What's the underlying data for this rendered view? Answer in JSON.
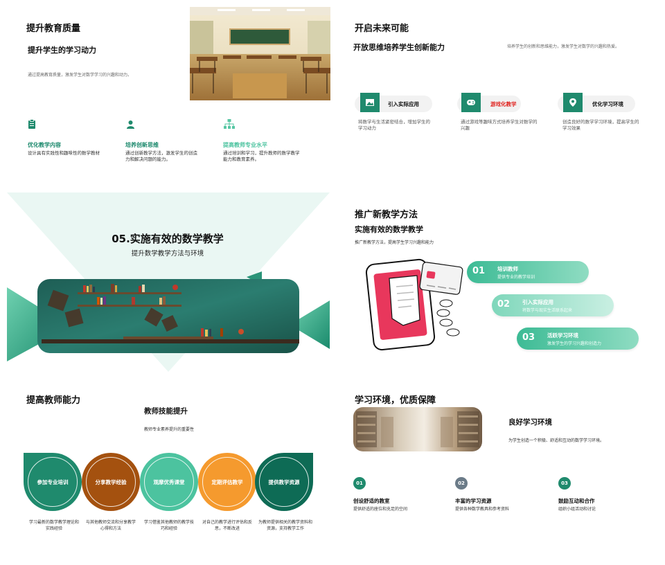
{
  "slide1": {
    "title": "提升教育质量",
    "subtitle": "提升学生的学习动力",
    "desc": "通过提高教育质量，激发学生对数学学习的兴趣和动力。",
    "features": [
      {
        "title": "优化教学内容",
        "desc": "设计具有实践性和趣味性的数学教材",
        "icon": "clipboard-icon"
      },
      {
        "title": "培养创新思维",
        "desc": "通过创新教学方法，激发学生的创造力和解决问题的能力。",
        "icon": "person-icon"
      },
      {
        "title": "提高教师专业水平",
        "desc": "通过培训和学习，提升教师的数学教学能力和教育素养。",
        "icon": "org-chart-icon"
      }
    ]
  },
  "slide2": {
    "title": "开启未来可能",
    "subtitle": "开放思维培养学生创新能力",
    "desc": "培养学生的创新和思维能力，激发学生对数学的兴趣和热爱。",
    "cards": [
      {
        "label": "引入实际应用",
        "desc": "将数学与生活紧密结合，增加学生的学习动力",
        "icon": "image-icon"
      },
      {
        "label": "游戏化教学",
        "desc": "通过游戏等趣味方式培养学生对数学的兴趣",
        "icon": "gamepad-icon"
      },
      {
        "label": "优化学习环境",
        "desc": "创造良好的数学学习环境，提高学生的学习效果",
        "icon": "location-icon"
      }
    ]
  },
  "slide3": {
    "title": "05.实施有效的数学教学",
    "subtitle": "提升数学教学方法与环境"
  },
  "slide4": {
    "title": "推广新教学方法",
    "subtitle": "实施有效的数学教学",
    "desc": "推广新教学方法，提高学生学习兴趣和能力",
    "items": [
      {
        "num": "01",
        "title": "培训教师",
        "desc": "提供专业的教学培训"
      },
      {
        "num": "02",
        "title": "引入实际应用",
        "desc": "将数学与现实生活联系起来"
      },
      {
        "num": "03",
        "title": "活跃学习环境",
        "desc": "激发学生的学习兴趣和创造力"
      }
    ]
  },
  "slide5": {
    "title": "提高教师能力",
    "subtitle": "教师技能提升",
    "desc": "教师专业素养提升的重要性",
    "circles": [
      {
        "label": "参加专业培训",
        "desc": "学习最新的数学教学理论和实践经验",
        "color": "#1f8a6d"
      },
      {
        "label": "分享教学经验",
        "desc": "与其他教师交流和分享教学心得和方法",
        "color": "#a4510f"
      },
      {
        "label": "观摩优秀课堂",
        "desc": "学习借鉴其他教师的教学技巧和经验",
        "color": "#4cc39f"
      },
      {
        "label": "定期评估教学",
        "desc": "对自己的教学进行评估和反思，不断改进",
        "color": "#f59a2e"
      },
      {
        "label": "提供教学资源",
        "desc": "为教师提供相关的教学资料和资源，支持教学工作",
        "color": "#0e6b55"
      }
    ]
  },
  "slide6": {
    "title": "学习环境，优质保障",
    "subtitle": "良好学习环境",
    "desc": "为学生创造一个积极、舒适和互动的数学学习环境。",
    "items": [
      {
        "num": "01",
        "title": "创设舒适的教室",
        "desc": "提供舒适的座位和充足的空间",
        "color": "#1f8a6d"
      },
      {
        "num": "02",
        "title": "丰富的学习资源",
        "desc": "提供各种数学教具和参考资料",
        "color": "#6b7b88"
      },
      {
        "num": "03",
        "title": "鼓励互动和合作",
        "desc": "组织小组活动和讨论",
        "color": "#1f8a6d"
      }
    ]
  }
}
